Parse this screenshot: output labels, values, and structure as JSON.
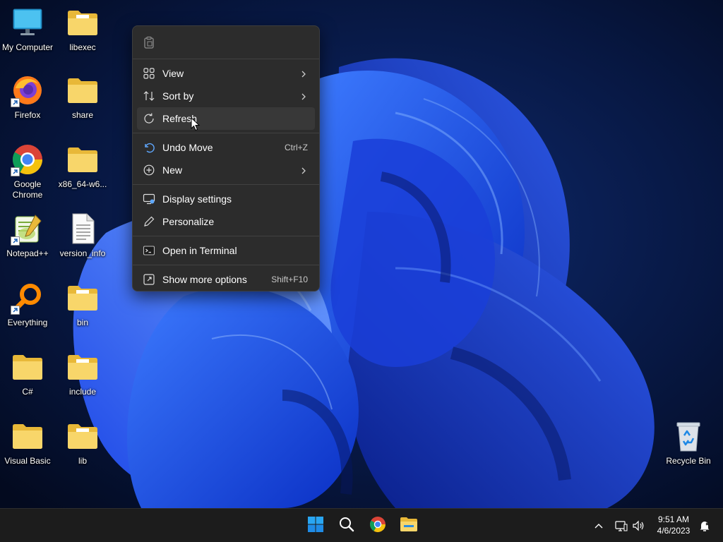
{
  "desktop": {
    "icons": [
      {
        "label": "My Computer",
        "icon": "monitor-icon"
      },
      {
        "label": "libexec",
        "icon": "folder-icon"
      },
      {
        "label": "Firefox",
        "icon": "firefox-icon"
      },
      {
        "label": "share",
        "icon": "folder-icon"
      },
      {
        "label": "Google Chrome",
        "icon": "chrome-icon"
      },
      {
        "label": "x86_64-w6...",
        "icon": "folder-icon"
      },
      {
        "label": "Notepad++",
        "icon": "notepad-plus-plus-icon"
      },
      {
        "label": "version_info",
        "icon": "text-file-icon"
      },
      {
        "label": "Everything",
        "icon": "everything-search-icon"
      },
      {
        "label": "bin",
        "icon": "folder-icon"
      },
      {
        "label": "C#",
        "icon": "folder-icon"
      },
      {
        "label": "include",
        "icon": "folder-icon"
      },
      {
        "label": "Visual Basic",
        "icon": "folder-icon"
      },
      {
        "label": "lib",
        "icon": "folder-icon"
      },
      {
        "label": "Recycle Bin",
        "icon": "recycle-bin-icon"
      }
    ]
  },
  "context_menu": {
    "top_icon": "clipboard-icon",
    "items": [
      {
        "label": "View",
        "icon": "grid-icon",
        "submenu": true
      },
      {
        "label": "Sort by",
        "icon": "sort-icon",
        "submenu": true
      },
      {
        "label": "Refresh",
        "icon": "refresh-icon",
        "hovered": true
      },
      {
        "label": "Undo Move",
        "icon": "undo-icon",
        "shortcut": "Ctrl+Z"
      },
      {
        "label": "New",
        "icon": "plus-circle-icon",
        "submenu": true
      },
      {
        "label": "Display settings",
        "icon": "display-icon"
      },
      {
        "label": "Personalize",
        "icon": "pen-icon"
      },
      {
        "label": "Open in Terminal",
        "icon": "terminal-icon"
      },
      {
        "label": "Show more options",
        "icon": "expand-icon",
        "shortcut": "Shift+F10"
      }
    ]
  },
  "taskbar": {
    "pinned": [
      "start-icon",
      "search-icon",
      "chrome-icon",
      "file-explorer-icon"
    ],
    "tray": [
      "chevron-up-icon",
      "network-icon",
      "volume-icon",
      "notification-icon"
    ],
    "clock": {
      "time": "9:51 AM",
      "date": "4/6/2023"
    }
  },
  "colors": {
    "menu_bg": "#2c2c2c",
    "menu_hover": "#383838",
    "taskbar_bg": "#1c1c1c",
    "accent": "#0078d4",
    "folder": "#f3c84a"
  }
}
